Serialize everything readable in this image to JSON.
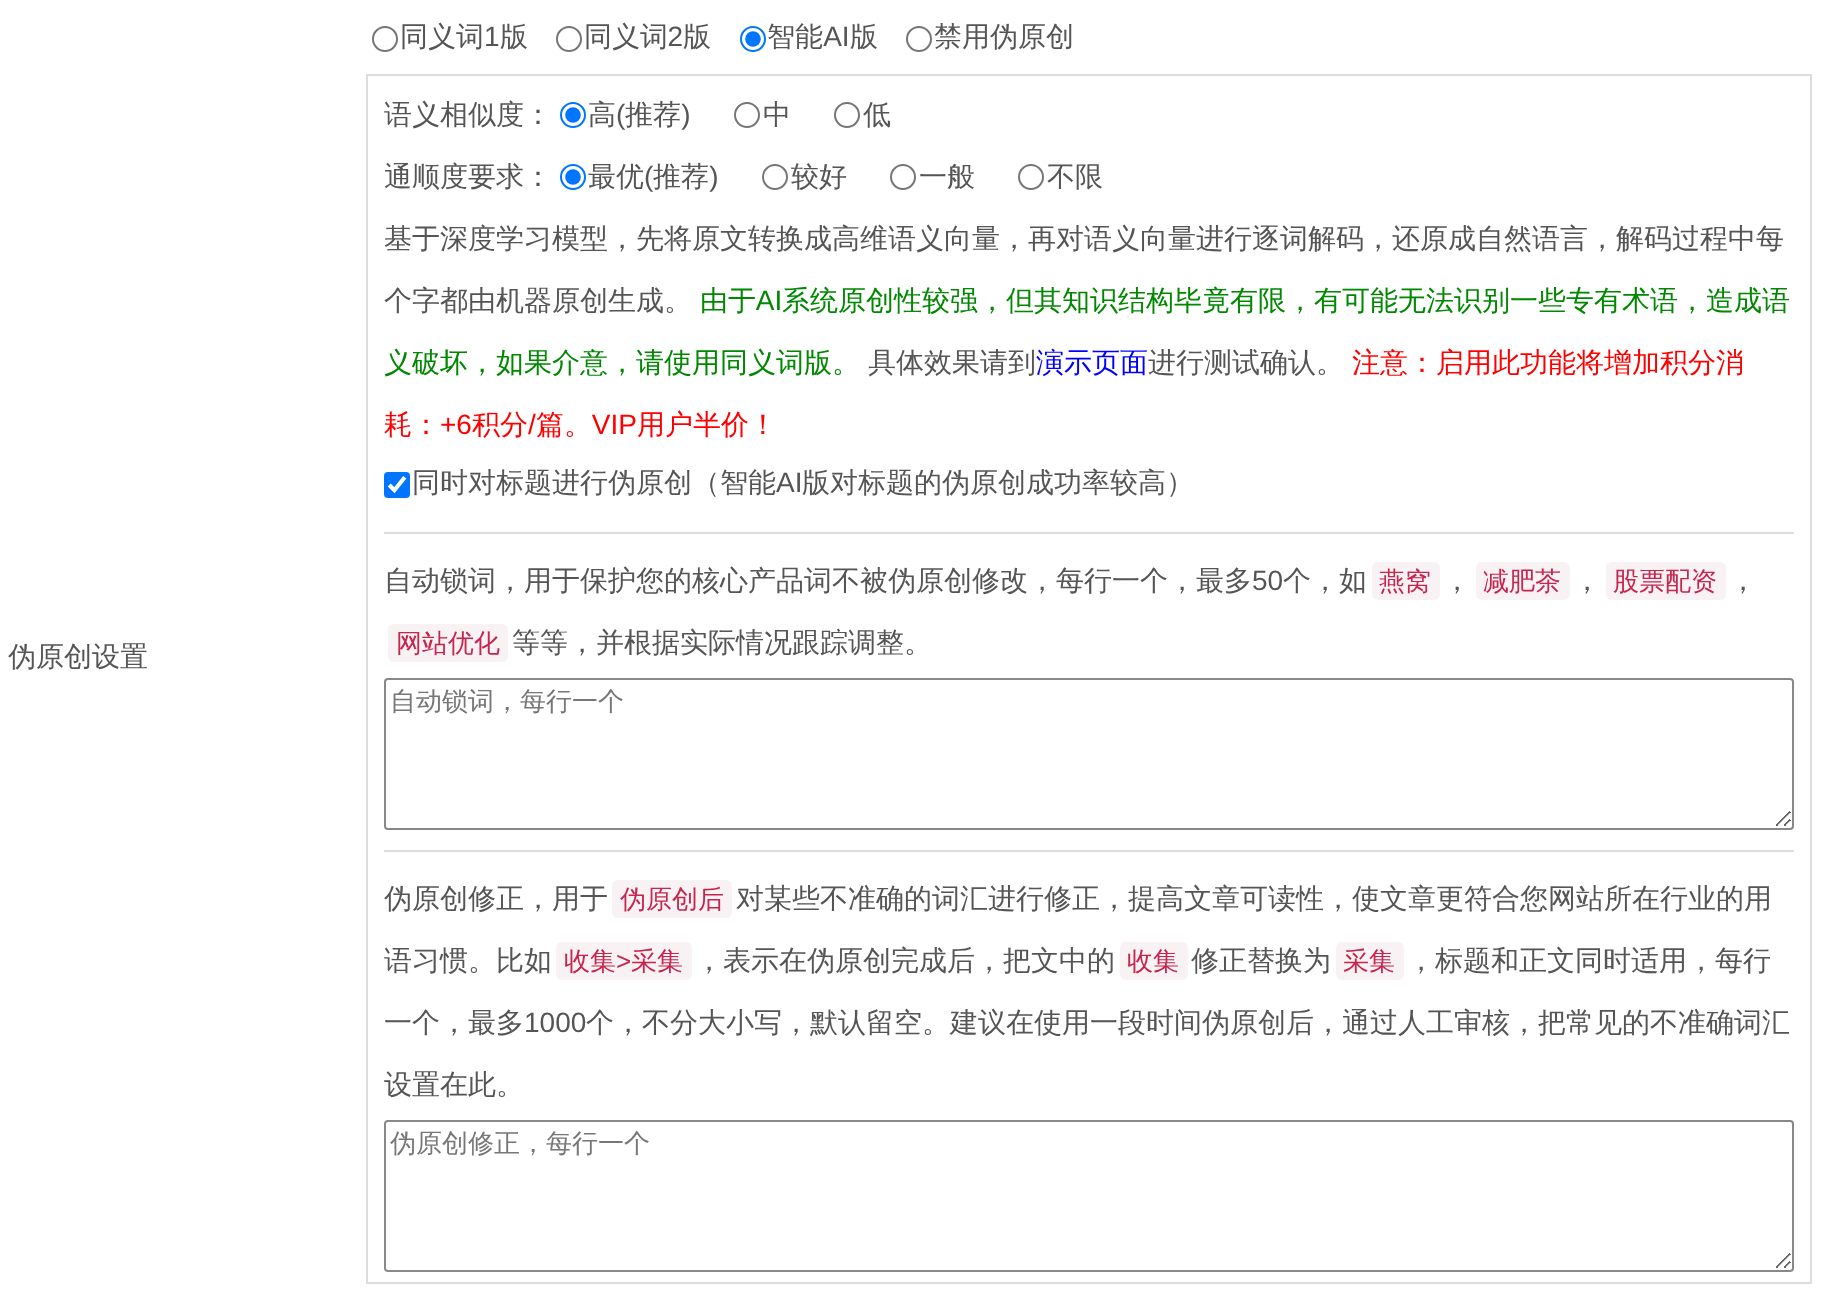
{
  "section_label": "伪原创设置",
  "modes": [
    {
      "label": "同义词1版",
      "selected": false
    },
    {
      "label": "同义词2版",
      "selected": false
    },
    {
      "label": "智能AI版",
      "selected": true
    },
    {
      "label": "禁用伪原创",
      "selected": false
    }
  ],
  "similarity": {
    "label": "语义相似度：",
    "options": [
      {
        "label": "高(推荐)",
        "selected": true
      },
      {
        "label": "中",
        "selected": false
      },
      {
        "label": "低",
        "selected": false
      }
    ]
  },
  "fluency": {
    "label": "通顺度要求：",
    "options": [
      {
        "label": "最优(推荐)",
        "selected": true
      },
      {
        "label": "较好",
        "selected": false
      },
      {
        "label": "一般",
        "selected": false
      },
      {
        "label": "不限",
        "selected": false
      }
    ]
  },
  "description": [
    {
      "kind": "text",
      "text": "基于深度学习模型，先将原文转换成高维语义向量，再对语义向量进行逐词解码，还原成自然语言，解码过程中每个字都由机器原创生成。 "
    },
    {
      "kind": "note",
      "text": "由于AI系统原创性较强，但其知识结构毕竟有限，有可能无法识别一些专有术语，造成语义破坏，如果介意，请使用同义词版。"
    },
    {
      "kind": "text",
      "text": " 具体效果请到"
    },
    {
      "kind": "link",
      "text": "演示页面"
    },
    {
      "kind": "text",
      "text": "进行测试确认。 "
    },
    {
      "kind": "warning",
      "text": "注意：启用此功能将增加积分消耗：+6积分/篇。VIP用户半价！"
    }
  ],
  "title_option": {
    "label": "同时对标题进行伪原创（智能AI版对标题的伪原创成功率较高）",
    "checked": true
  },
  "lock_words": {
    "description": [
      {
        "kind": "text",
        "text": "自动锁词，用于保护您的核心产品词不被伪原创修改，每行一个，最多50个，如"
      },
      {
        "kind": "tag",
        "text": "燕窝"
      },
      {
        "kind": "text",
        "text": "，"
      },
      {
        "kind": "tag",
        "text": "减肥茶"
      },
      {
        "kind": "text",
        "text": "，"
      },
      {
        "kind": "tag",
        "text": "股票配资"
      },
      {
        "kind": "text",
        "text": "，"
      },
      {
        "kind": "tag",
        "text": "网站优化"
      },
      {
        "kind": "text",
        "text": "等等，并根据实际情况跟踪调整。"
      }
    ],
    "placeholder": "自动锁词，每行一个"
  },
  "corrections": {
    "description": [
      {
        "kind": "text",
        "text": "伪原创修正，用于"
      },
      {
        "kind": "tag",
        "text": "伪原创后"
      },
      {
        "kind": "text",
        "text": "对某些不准确的词汇进行修正，提高文章可读性，使文章更符合您网站所在行业的用语习惯。比如"
      },
      {
        "kind": "tag",
        "text": "收集>采集"
      },
      {
        "kind": "text",
        "text": "，表示在伪原创完成后，把文中的"
      },
      {
        "kind": "tag",
        "text": "收集"
      },
      {
        "kind": "text",
        "text": "修正替换为"
      },
      {
        "kind": "tag",
        "text": "采集"
      },
      {
        "kind": "text",
        "text": "，标题和正文同时适用，每行一个，最多1000个，不分大小写，默认留空。建议在使用一段时间伪原创后，通过人工审核，把常见的不准确词汇设置在此。"
      }
    ],
    "placeholder": "伪原创修正，每行一个"
  }
}
